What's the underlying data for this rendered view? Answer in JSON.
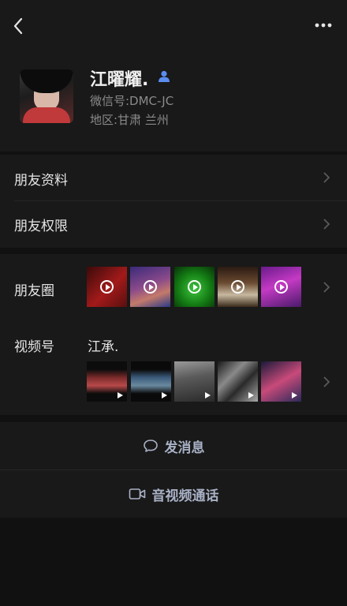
{
  "profile": {
    "nickname": "江曜耀.",
    "wechat_id": "微信号:DMC-JC",
    "region": "地区:甘肃 兰州"
  },
  "menu": {
    "friend_info": "朋友资料",
    "friend_permissions": "朋友权限"
  },
  "moments": {
    "label": "朋友圈",
    "thumbnails": [
      "video",
      "video",
      "video",
      "video",
      "video"
    ]
  },
  "channels": {
    "label": "视频号",
    "name": "江承.",
    "thumbnails": [
      "video",
      "video",
      "video",
      "video",
      "video"
    ]
  },
  "actions": {
    "message": "发消息",
    "call": "音视频通话"
  },
  "colors": {
    "background": "#111111",
    "surface": "#191919",
    "action_text": "#a9b1c6",
    "friend_icon": "#5b8cf0"
  },
  "icons": [
    "back-arrow-icon",
    "more-icon",
    "friend-icon",
    "chevron-right-icon",
    "play-icon",
    "chat-bubble-icon",
    "video-camera-icon"
  ]
}
